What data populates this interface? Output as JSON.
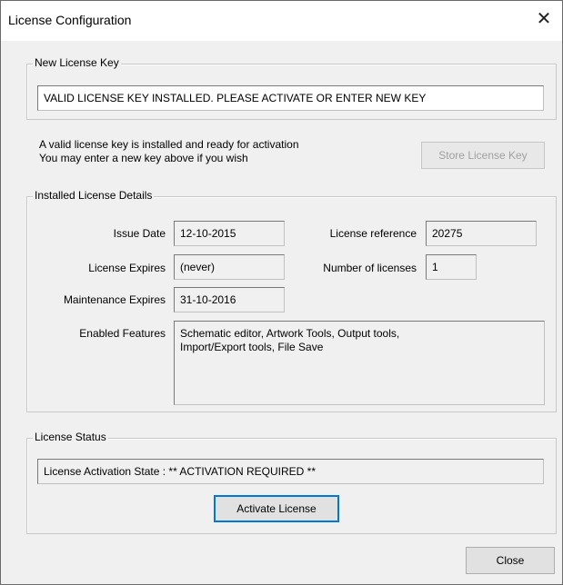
{
  "window": {
    "title": "License Configuration",
    "close_glyph": "✕"
  },
  "new_key": {
    "group_label": "New License Key",
    "input_value": "VALID LICENSE KEY INSTALLED. PLEASE ACTIVATE OR ENTER NEW KEY",
    "note_line1": "A valid license key is installed and ready for activation",
    "note_line2": "You may enter a new key above if you wish",
    "store_button": "Store License Key"
  },
  "details": {
    "group_label": "Installed License Details",
    "issue_date_label": "Issue Date",
    "issue_date_value": "12-10-2015",
    "license_reference_label": "License reference",
    "license_reference_value": "20275",
    "license_expires_label": "License Expires",
    "license_expires_value": "(never)",
    "number_of_licenses_label": "Number of licenses",
    "number_of_licenses_value": "1",
    "maintenance_expires_label": "Maintenance Expires",
    "maintenance_expires_value": "31-10-2016",
    "enabled_features_label": "Enabled Features",
    "enabled_features_line1": "Schematic editor, Artwork Tools, Output tools,",
    "enabled_features_line2": "Import/Export tools, File Save"
  },
  "status": {
    "group_label": "License Status",
    "state_text": "License Activation State : ** ACTIVATION REQUIRED **",
    "activate_button": "Activate License"
  },
  "footer": {
    "close_button": "Close"
  }
}
